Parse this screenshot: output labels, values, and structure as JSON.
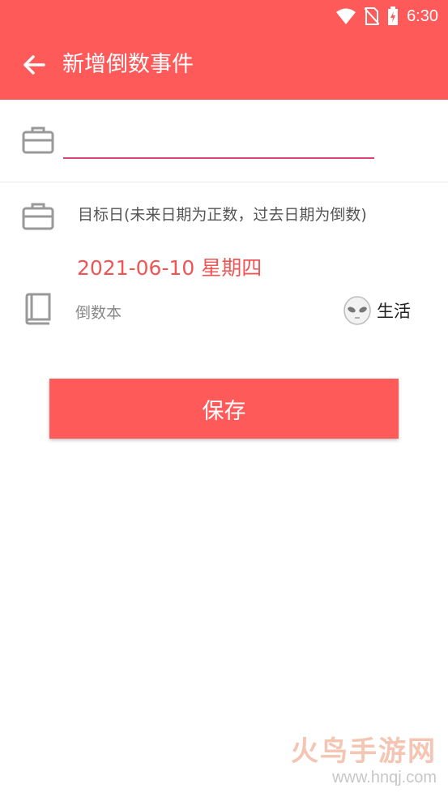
{
  "status_bar": {
    "time": "6:30",
    "icons": [
      "wifi-icon",
      "no-sim-icon",
      "battery-charging-icon"
    ]
  },
  "header": {
    "back_icon": "arrow-left-icon",
    "title": "新增倒数事件"
  },
  "form": {
    "name_input": {
      "value": "",
      "placeholder": ""
    },
    "target_label": "目标日(未来日期为正数，过去日期为倒数)",
    "target_date": "2021-06-10 星期四",
    "book_label": "倒数本",
    "category": {
      "icon": "alien-icon",
      "label": "生活"
    },
    "save_label": "保存"
  },
  "watermark": {
    "main": "火鸟手游网",
    "sub": "www.hnqj.com"
  },
  "colors": {
    "accent": "#fe5a5a",
    "date_text": "#f05555",
    "underline": "#e0407a"
  }
}
